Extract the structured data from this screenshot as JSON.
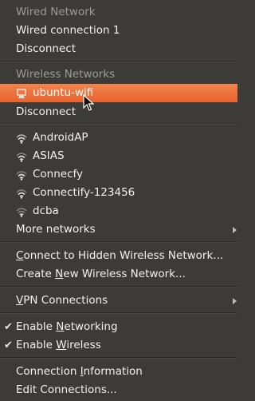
{
  "wired": {
    "header": "Wired Network",
    "connection": "Wired connection 1",
    "disconnect": "Disconnect"
  },
  "wireless": {
    "header": "Wireless Networks",
    "active": "ubuntu-wifi",
    "disconnect": "Disconnect",
    "networks": [
      "AndroidAP",
      "ASIAS",
      "Connecfy",
      "Connectify-123456",
      "dcba"
    ],
    "more": "More networks"
  },
  "actions": {
    "hidden_pre": "",
    "hidden_mn": "C",
    "hidden_post": "onnect to Hidden Wireless Network...",
    "create_pre": "Create ",
    "create_mn": "N",
    "create_post": "ew Wireless Network..."
  },
  "vpn": {
    "pre": "",
    "mn": "V",
    "post": "PN Connections"
  },
  "toggles": {
    "networking_pre": "Enable ",
    "networking_mn": "N",
    "networking_post": "etworking",
    "wireless_pre": "Enable ",
    "wireless_mn": "W",
    "wireless_post": "ireless",
    "check": "✔"
  },
  "info": {
    "conn_info_pre": "Connection ",
    "conn_info_mn": "I",
    "conn_info_post": "nformation",
    "edit": "Edit Connections..."
  },
  "colors": {
    "menu_bg": "#3c3b37",
    "highlight": "#e8632e",
    "header_text": "#9d9b96",
    "text": "#f2f1f0"
  },
  "icons": {
    "active": "computer-network-icon",
    "wifi": "wifi-signal-icon",
    "submenu": "submenu-arrow-icon",
    "check": "checkmark-icon"
  }
}
